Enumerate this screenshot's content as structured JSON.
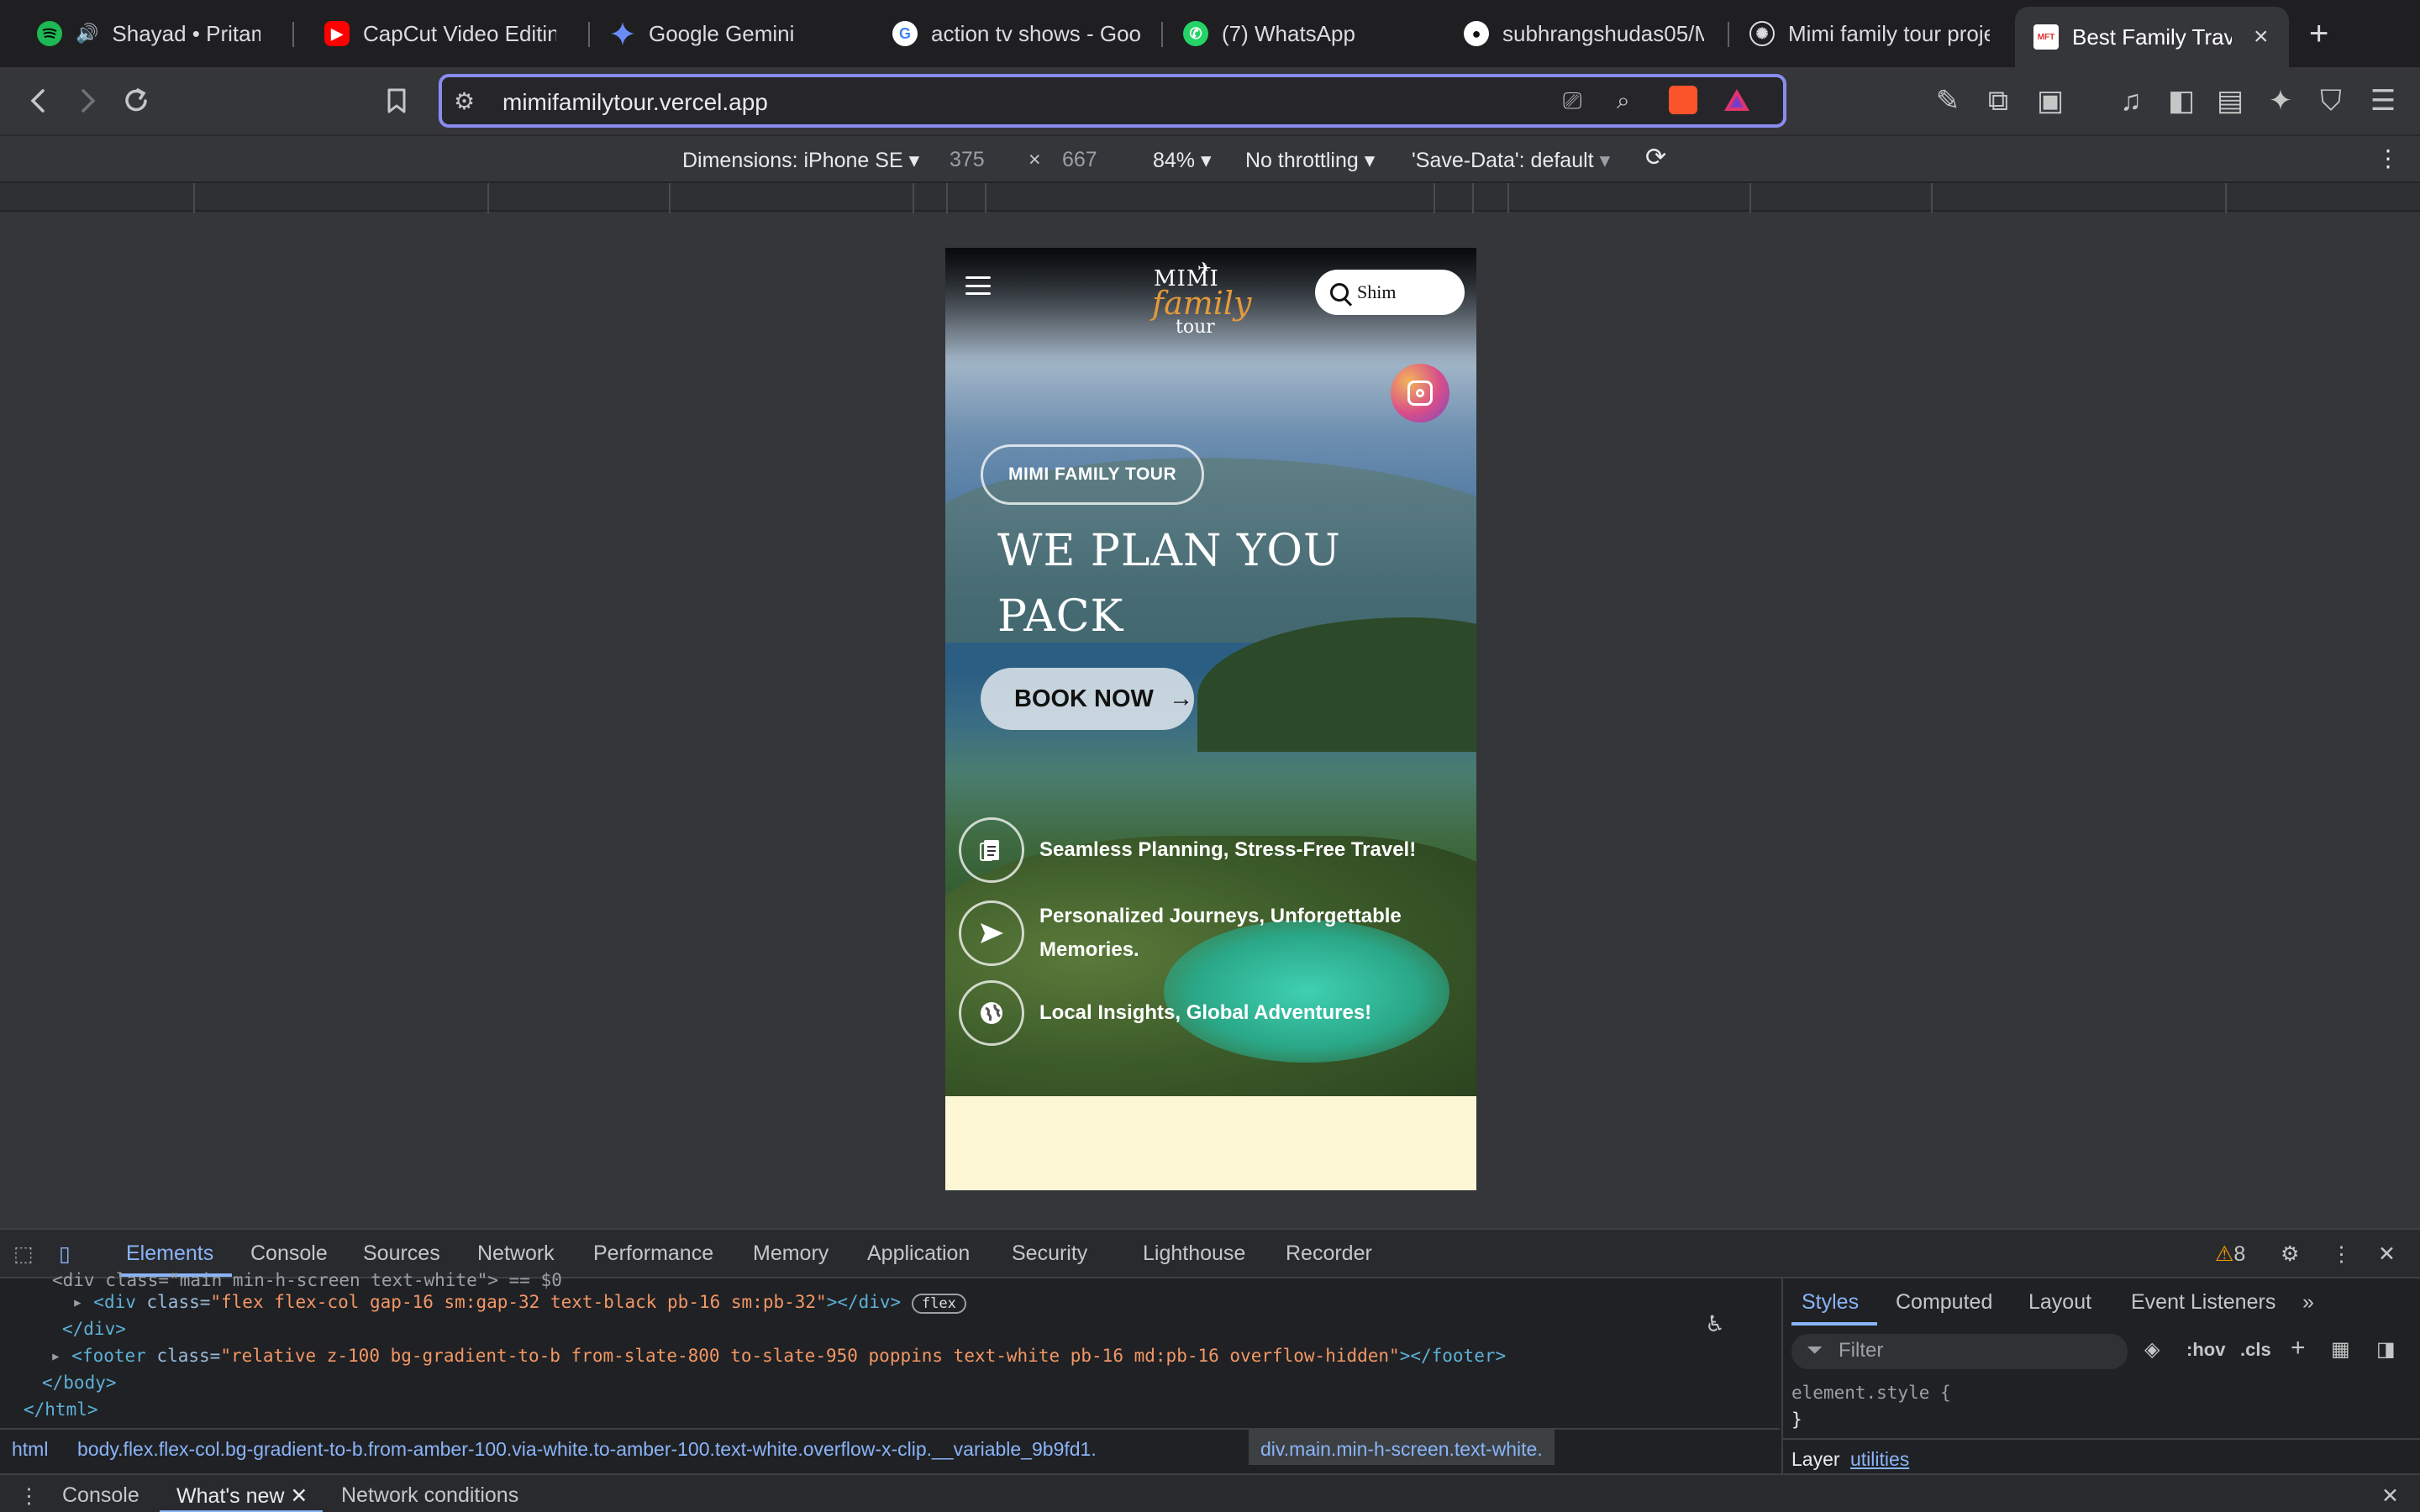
{
  "tabs": [
    {
      "title": "Shayad • Pritam, A",
      "icon": "spotify-icon"
    },
    {
      "title": "CapCut Video Editing",
      "icon": "youtube-icon"
    },
    {
      "title": "Google Gemini",
      "icon": "gemini-icon"
    },
    {
      "title": "action tv shows - Goo",
      "icon": "google-icon"
    },
    {
      "title": "(7) WhatsApp",
      "icon": "whatsapp-icon"
    },
    {
      "title": "subhrangshudas05/M",
      "icon": "github-icon"
    },
    {
      "title": "Mimi family tour proje",
      "icon": "openai-icon"
    },
    {
      "title": "Best Family Trave",
      "icon": "mft-favicon",
      "favicon_text": "MFT",
      "active": true
    }
  ],
  "new_tab": "+",
  "tab_close": "×",
  "omnibox": {
    "url": "mimifamilytour.vercel.app"
  },
  "device_toolbar": {
    "dimensions": "Dimensions: iPhone SE",
    "width": "375",
    "times": "×",
    "height": "667",
    "zoom": "84%",
    "throttling": "No throttling",
    "save_data": "'Save-Data': default"
  },
  "site": {
    "logo": {
      "line1": "MIMI",
      "line2": "family",
      "line3": "tour"
    },
    "search_value": "Shim",
    "badge": "MIMI FAMILY TOUR",
    "headline": "WE PLAN YOU PACK",
    "book_button": "BOOK NOW",
    "book_arrow": "→",
    "features": [
      {
        "text": "Seamless Planning, Stress-Free Travel!",
        "icon": "clipboard-icon"
      },
      {
        "text": "Personalized Journeys, Unforgettable Memories.",
        "icon": "send-icon"
      },
      {
        "text": "Local Insights, Global Adventures!",
        "icon": "globe-icon"
      }
    ],
    "colors": {
      "accent": "#e49a3a",
      "footer_bg": "#fef7d6"
    }
  },
  "devtools": {
    "tabs": [
      "Elements",
      "Console",
      "Sources",
      "Network",
      "Performance",
      "Memory",
      "Application",
      "Security",
      "Lighthouse",
      "Recorder"
    ],
    "warning_count": "8",
    "dom_lines": {
      "l0": "<div class=\"main min-h-screen text-white\"> == $0",
      "l1_tag_open": "<div ",
      "l1_attr": "class=",
      "l1_val": "\"flex flex-col gap-16 sm:gap-32 text-black pb-16 sm:pb-32\"",
      "l1_close": "></div>",
      "l1_pill": "flex",
      "l2": "</div>",
      "l3_tag_open": "<footer ",
      "l3_attr": "class=",
      "l3_val": "\"relative z-100 bg-gradient-to-b from-slate-800 to-slate-950 poppins text-white pb-16 md:pb-16 overflow-hidden\"",
      "l3_close": "></footer>",
      "l4": "</body>",
      "l5": "</html>"
    },
    "styles_tabs": [
      "Styles",
      "Computed",
      "Layout",
      "Event Listeners"
    ],
    "filter_placeholder": "Filter",
    "hov": ":hov",
    "cls": ".cls",
    "element_style_open": "element.style {",
    "element_style_close": "}",
    "layer_label": "Layer",
    "layer_link": "utilities",
    "breadcrumb": [
      "html",
      "body.flex.flex-col.bg-gradient-to-b.from-amber-100.via-white.to-amber-100.text-white.overflow-x-clip.__variable_9b9fd1.",
      "div.main.min-h-screen.text-white."
    ],
    "drawer_tabs": [
      "Console",
      "What's new",
      "Network conditions"
    ]
  }
}
